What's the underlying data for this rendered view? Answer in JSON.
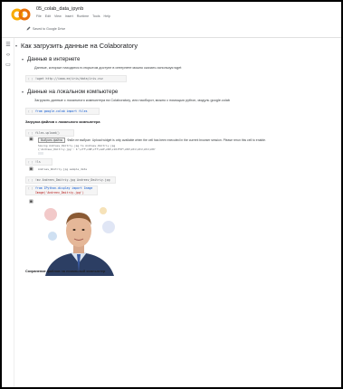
{
  "notebook": {
    "title": "05_colab_data_ipynb",
    "menu": [
      "File",
      "Edit",
      "View",
      "Insert",
      "Runtime",
      "Tools",
      "Help"
    ],
    "saved_status": "Saved to Google Drive"
  },
  "sections": {
    "main_heading": "Как загрузить данные на Colaboratory",
    "internet": {
      "heading": "Данные в интернете",
      "para": "Данные, которые находятся в открытом доступе в интернете можно скачать используя wget",
      "code": "!wget http://iaaa.ee/iris/data/iris.csv",
      "cell_num": "[ ]"
    },
    "local": {
      "heading": "Данные на локальном компьютере",
      "para": "Загрузить данные с локального компьютера на Colaboratory, или наоборот, можно с помощью python, модуль google.colab",
      "code": "from google.colab import files",
      "cell_num": "[ ]",
      "upload_label": "Загрузка файлов с локального компьютера",
      "upload_code": "files.upload()",
      "upload_cell_num": "[ ]",
      "choose_btn": "Выбрать файлы",
      "no_file": "Файл не выбран",
      "upload_msg": "Upload widget is only available when the cell has been executed in the current browser session. Please rerun this cell to enable.",
      "saving_out1": "Saving Andreev_Dmitriy.jpg to Andreev_Dmitriy.jpg",
      "saving_out2": "{'Andreev_Dmitriy.jpg': b'\\xff\\xd8\\xff\\xe0\\x00\\x10JFIF\\x00\\x01\\x01\\x01\\x00'",
      "ls_code": "!ls",
      "ls_cell_num": "[ ]",
      "ls_out": "Andreev_Dmitriy.jpg sample_data",
      "mv_code": "!mv Andreev_Dmitriy.jpg   Andreev_Dmitriy.jpg",
      "mv_cell_num": "[ ]",
      "img_code_1": "from IPython.display import Image",
      "img_code_2": "Image('Andreev_Dmitriy.jpg')",
      "img_cell_num": "[ ]",
      "save_label": "Сохранение файлов на локальный компьютер"
    }
  },
  "colors": {
    "accent": "#0b57d0",
    "string": "#b31412",
    "logo_orange": "#f9ab00",
    "logo_yellow": "#e8710a"
  }
}
